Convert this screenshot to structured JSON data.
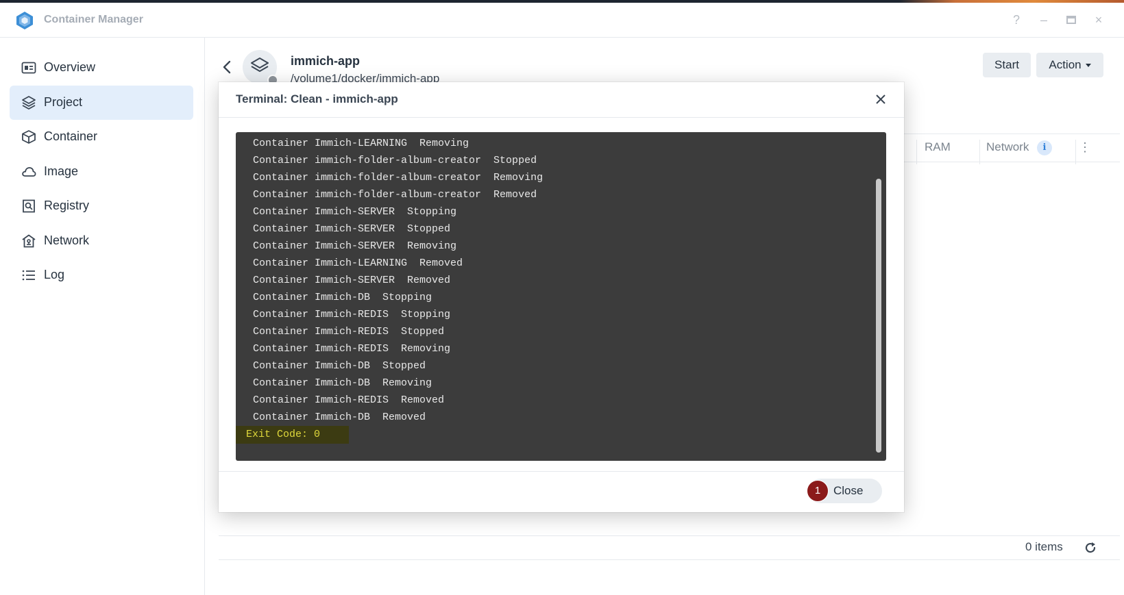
{
  "app": {
    "title": "Container Manager",
    "window_controls": [
      "?",
      "–",
      "□",
      "×"
    ]
  },
  "sidebar": {
    "items": [
      {
        "label": "Overview",
        "icon": "overview-icon",
        "active": false
      },
      {
        "label": "Project",
        "icon": "project-icon",
        "active": true
      },
      {
        "label": "Container",
        "icon": "container-icon",
        "active": false
      },
      {
        "label": "Image",
        "icon": "image-icon",
        "active": false
      },
      {
        "label": "Registry",
        "icon": "registry-icon",
        "active": false
      },
      {
        "label": "Network",
        "icon": "network-icon",
        "active": false
      },
      {
        "label": "Log",
        "icon": "log-icon",
        "active": false
      }
    ]
  },
  "project": {
    "name": "immich-app",
    "path": "/volume1/docker/immich-app",
    "start_label": "Start",
    "action_label": "Action"
  },
  "table": {
    "columns": [
      "RAM",
      "Network"
    ],
    "items_count": "0 items"
  },
  "dialog": {
    "title": "Terminal: Clean - immich-app",
    "close_label": "Close",
    "step_badge": "1",
    "exit_code": "Exit Code: 0",
    "lines": [
      "Container Immich-LEARNING  Removing",
      "Container immich-folder-album-creator  Stopped",
      "Container immich-folder-album-creator  Removing",
      "Container immich-folder-album-creator  Removed",
      "Container Immich-SERVER  Stopping",
      "Container Immich-SERVER  Stopped",
      "Container Immich-SERVER  Removing",
      "Container Immich-LEARNING  Removed",
      "Container Immich-SERVER  Removed",
      "Container Immich-DB  Stopping",
      "Container Immich-REDIS  Stopping",
      "Container Immich-REDIS  Stopped",
      "Container Immich-REDIS  Removing",
      "Container Immich-DB  Stopped",
      "Container Immich-DB  Removing",
      "Container Immich-REDIS  Removed",
      "Container Immich-DB  Removed"
    ]
  },
  "colors": {
    "accent": "#2f7fd8",
    "active_nav_bg": "#e3eefb",
    "terminal_bg": "#3c3c3c",
    "exit_code_text": "#e0d93c",
    "badge": "#8b1a1a"
  }
}
